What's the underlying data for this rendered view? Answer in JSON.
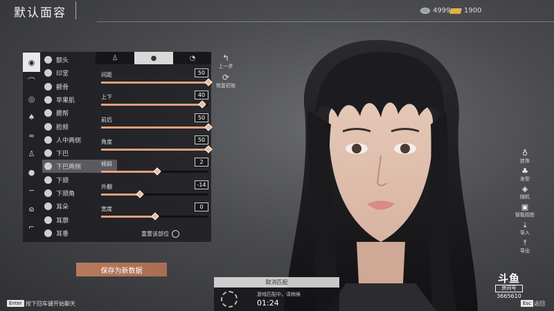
{
  "header": {
    "title": "默认面容"
  },
  "currency": {
    "silver": "4999",
    "gold": "1900"
  },
  "tabs": [
    "face",
    "front",
    "side"
  ],
  "categories": [
    {
      "icon": "face-outline-icon",
      "glyph": "◉",
      "selected": true
    },
    {
      "icon": "brow-icon",
      "glyph": "⌒"
    },
    {
      "icon": "eye-icon",
      "glyph": "◎"
    },
    {
      "icon": "nose-icon",
      "glyph": "♠"
    },
    {
      "icon": "mouth-icon",
      "glyph": "≈"
    },
    {
      "icon": "body-icon",
      "glyph": "♙"
    },
    {
      "icon": "head-icon",
      "glyph": "●"
    },
    {
      "icon": "ear-icon",
      "glyph": "∽"
    },
    {
      "icon": "eyelash-icon",
      "glyph": "ɷ"
    },
    {
      "icon": "hairline-icon",
      "glyph": "⌐"
    }
  ],
  "sub_items": [
    "额头",
    "印堂",
    "颧骨",
    "苹果肌",
    "腮帮",
    "脸颊",
    "人中两侧",
    "下巴",
    "下巴两侧",
    "下颌",
    "下颌角",
    "耳朵",
    "耳廓",
    "耳垂"
  ],
  "selected_sub": 8,
  "sliders": [
    {
      "label": "间距",
      "value": "50",
      "fill": 1.0
    },
    {
      "label": "上下",
      "value": "40",
      "fill": 0.94
    },
    {
      "label": "前后",
      "value": "50",
      "fill": 1.0
    },
    {
      "label": "角度",
      "value": "50",
      "fill": 1.0
    },
    {
      "label": "倾斜",
      "value": "2",
      "fill": 0.52
    },
    {
      "label": "外翻",
      "value": "-14",
      "fill": 0.36
    },
    {
      "label": "宽度",
      "value": "0",
      "fill": 0.5
    }
  ],
  "reset_part": "重置该部位",
  "side_buttons": {
    "undo": "上一步",
    "restore": "恢复初始"
  },
  "save_label": "保存为新数据",
  "right_tools": [
    {
      "label": "挂饰",
      "icon": "ornament-icon",
      "glyph": "♁"
    },
    {
      "label": "发型",
      "icon": "hairstyle-icon",
      "glyph": "♣"
    },
    {
      "label": "随机",
      "icon": "dice-icon",
      "glyph": "◈"
    },
    {
      "label": "智能捏脸",
      "icon": "smart-face-icon",
      "glyph": "▣"
    },
    {
      "label": "导入",
      "icon": "import-icon",
      "glyph": "⤓"
    },
    {
      "label": "导出",
      "icon": "export-icon",
      "glyph": "⤒"
    }
  ],
  "match": {
    "cancel": "取消匹配",
    "status": "游戏匹配中，请稍候",
    "timer": "01:24"
  },
  "chat": {
    "key": "Enter",
    "hint": "按下回车键开始聊天"
  },
  "watermark": {
    "logo": "斗鱼",
    "room_label": "房间号",
    "room_id": "3665610"
  },
  "back": {
    "key": "Esc",
    "label": "返回"
  },
  "colors": {
    "accent": "#e6a07a",
    "save_bg": "#b67a5c"
  }
}
